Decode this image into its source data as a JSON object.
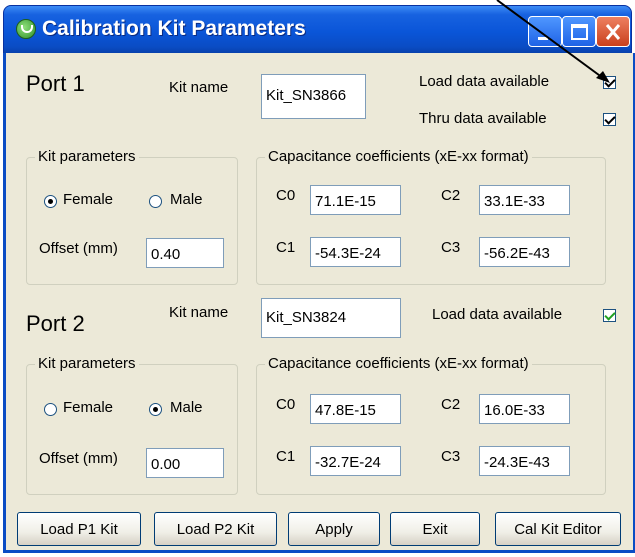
{
  "window": {
    "title": "Calibration Kit Parameters"
  },
  "port1": {
    "title": "Port 1",
    "kit_name_label": "Kit name",
    "kit_name": "Kit_SN3866",
    "load_label": "Load data available",
    "load_checked": true,
    "thru_label": "Thru data available",
    "thru_checked": true,
    "kit_params_title": "Kit parameters",
    "female_label": "Female",
    "male_label": "Male",
    "selected_gender": "Female",
    "offset_label": "Offset (mm)",
    "offset": "0.40",
    "cap_title": "Capacitance coefficients (xE-xx format)",
    "c0_label": "C0",
    "c0": "71.1E-15",
    "c1_label": "C1",
    "c1": "-54.3E-24",
    "c2_label": "C2",
    "c2": "33.1E-33",
    "c3_label": "C3",
    "c3": "-56.2E-43"
  },
  "port2": {
    "title": "Port 2",
    "kit_name_label": "Kit name",
    "kit_name": "Kit_SN3824",
    "load_label": "Load data available",
    "load_checked": true,
    "kit_params_title": "Kit parameters",
    "female_label": "Female",
    "male_label": "Male",
    "selected_gender": "Male",
    "offset_label": "Offset (mm)",
    "offset": "0.00",
    "cap_title": "Capacitance coefficients (xE-xx format)",
    "c0_label": "C0",
    "c0": "47.8E-15",
    "c1_label": "C1",
    "c1": "-32.7E-24",
    "c2_label": "C2",
    "c2": "16.0E-33",
    "c3_label": "C3",
    "c3": "-24.3E-43"
  },
  "buttons": {
    "load_p1": "Load P1 Kit",
    "load_p2": "Load P2 Kit",
    "apply": "Apply",
    "exit": "Exit",
    "editor": "Cal Kit Editor"
  },
  "colors": {
    "title_bar": "#0a55d8",
    "client_bg": "#ece9d8",
    "check_green": "#21a121",
    "close_red": "#c9401d"
  },
  "icons": [
    "app-icon",
    "minimize-icon",
    "maximize-icon",
    "close-icon",
    "arrow-annotation"
  ]
}
